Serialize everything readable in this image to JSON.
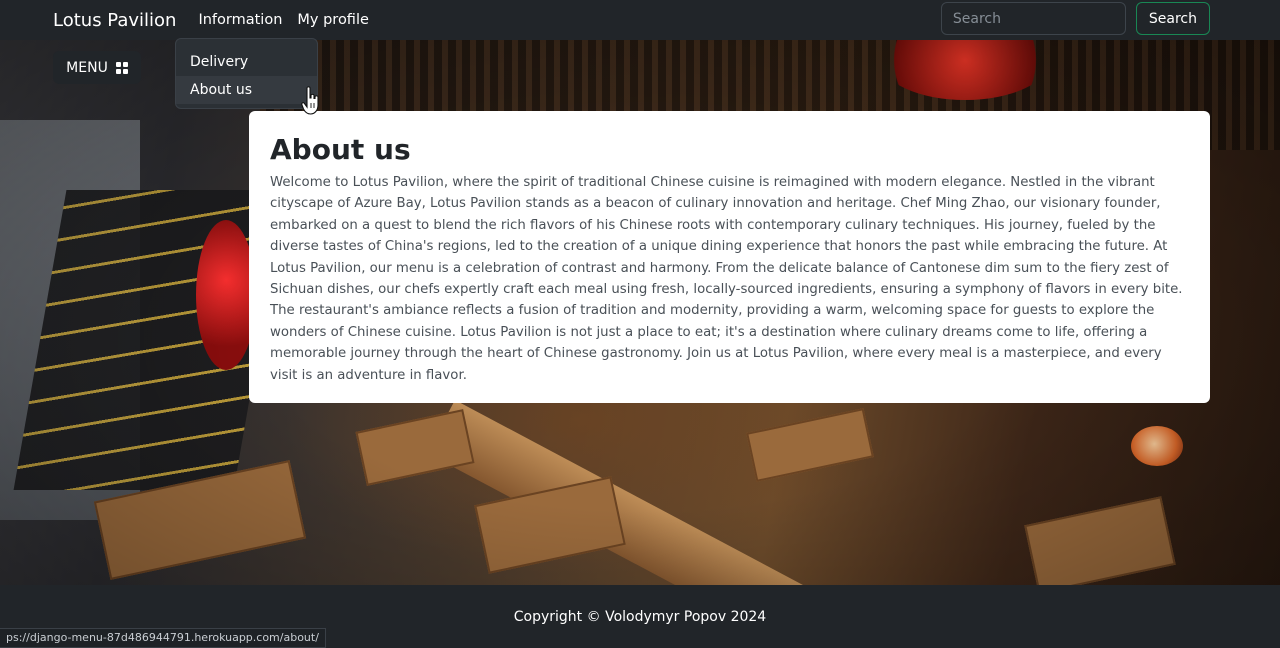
{
  "navbar": {
    "brand": "Lotus Pavilion",
    "links": [
      "Information",
      "My profile"
    ],
    "search": {
      "placeholder": "Search",
      "button_label": "Search"
    }
  },
  "menu_button": {
    "label": "MENU",
    "icon": "grid-icon"
  },
  "dropdown": {
    "items": [
      {
        "label": "Delivery"
      },
      {
        "label": "About us",
        "hovered": true
      }
    ]
  },
  "about": {
    "title": "About us",
    "text": "Welcome to Lotus Pavilion, where the spirit of traditional Chinese cuisine is reimagined with modern elegance. Nestled in the vibrant cityscape of Azure Bay, Lotus Pavilion stands as a beacon of culinary innovation and heritage. Chef Ming Zhao, our visionary founder, embarked on a quest to blend the rich flavors of his Chinese roots with contemporary culinary techniques. His journey, fueled by the diverse tastes of China's regions, led to the creation of a unique dining experience that honors the past while embracing the future. At Lotus Pavilion, our menu is a celebration of contrast and harmony. From the delicate balance of Cantonese dim sum to the fiery zest of Sichuan dishes, our chefs expertly craft each meal using fresh, locally-sourced ingredients, ensuring a symphony of flavors in every bite. The restaurant's ambiance reflects a fusion of tradition and modernity, providing a warm, welcoming space for guests to explore the wonders of Chinese cuisine. Lotus Pavilion is not just a place to eat; it's a destination where culinary dreams come to life, offering a memorable journey through the heart of Chinese gastronomy. Join us at Lotus Pavilion, where every meal is a masterpiece, and every visit is an adventure in flavor."
  },
  "footer": {
    "copyright": "Copyright © Volodymyr Popov 2024"
  },
  "status_bar": {
    "url": "ps://django-menu-87d486944791.herokuapp.com/about/"
  },
  "colors": {
    "navbar_bg": "#212529",
    "search_border": "#198754",
    "card_bg": "#ffffff",
    "text_muted": "#495057"
  }
}
